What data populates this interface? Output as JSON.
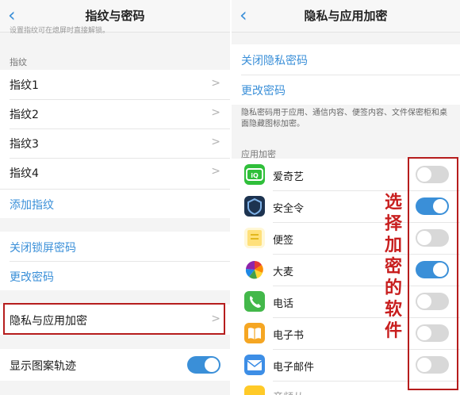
{
  "left": {
    "title": "指纹与密码",
    "top_hint": "设置指纹可在熄屏时直接解锁。",
    "section_label": "指纹",
    "fingerprints": [
      "指纹1",
      "指纹2",
      "指纹3",
      "指纹4"
    ],
    "add_fingerprint": "添加指纹",
    "close_lock_password": "关闭锁屏密码",
    "change_password": "更改密码",
    "privacy_encryption": "隐私与应用加密",
    "show_pattern": "显示图案轨迹",
    "show_pattern_on": true
  },
  "right": {
    "title": "隐私与应用加密",
    "close_privacy_password": "关闭隐私密码",
    "change_password": "更改密码",
    "description": "隐私密码用于应用、通信内容、便签内容、文件保密柜和桌面隐藏图标加密。",
    "section_label": "应用加密",
    "apps": [
      {
        "name": "爱奇艺",
        "on": false,
        "icon": "iqiyi-icon"
      },
      {
        "name": "安全令",
        "on": true,
        "icon": "security-token-icon"
      },
      {
        "name": "便签",
        "on": false,
        "icon": "notes-icon"
      },
      {
        "name": "大麦",
        "on": true,
        "icon": "damai-icon"
      },
      {
        "name": "电话",
        "on": false,
        "icon": "phone-icon"
      },
      {
        "name": "电子书",
        "on": false,
        "icon": "ebook-icon"
      },
      {
        "name": "电子邮件",
        "on": false,
        "icon": "email-icon"
      }
    ],
    "partial_app": "音频从..."
  },
  "annotation": "选择加密的软件",
  "colors": {
    "accent": "#3a8fd8",
    "highlight": "#b61d1d"
  }
}
